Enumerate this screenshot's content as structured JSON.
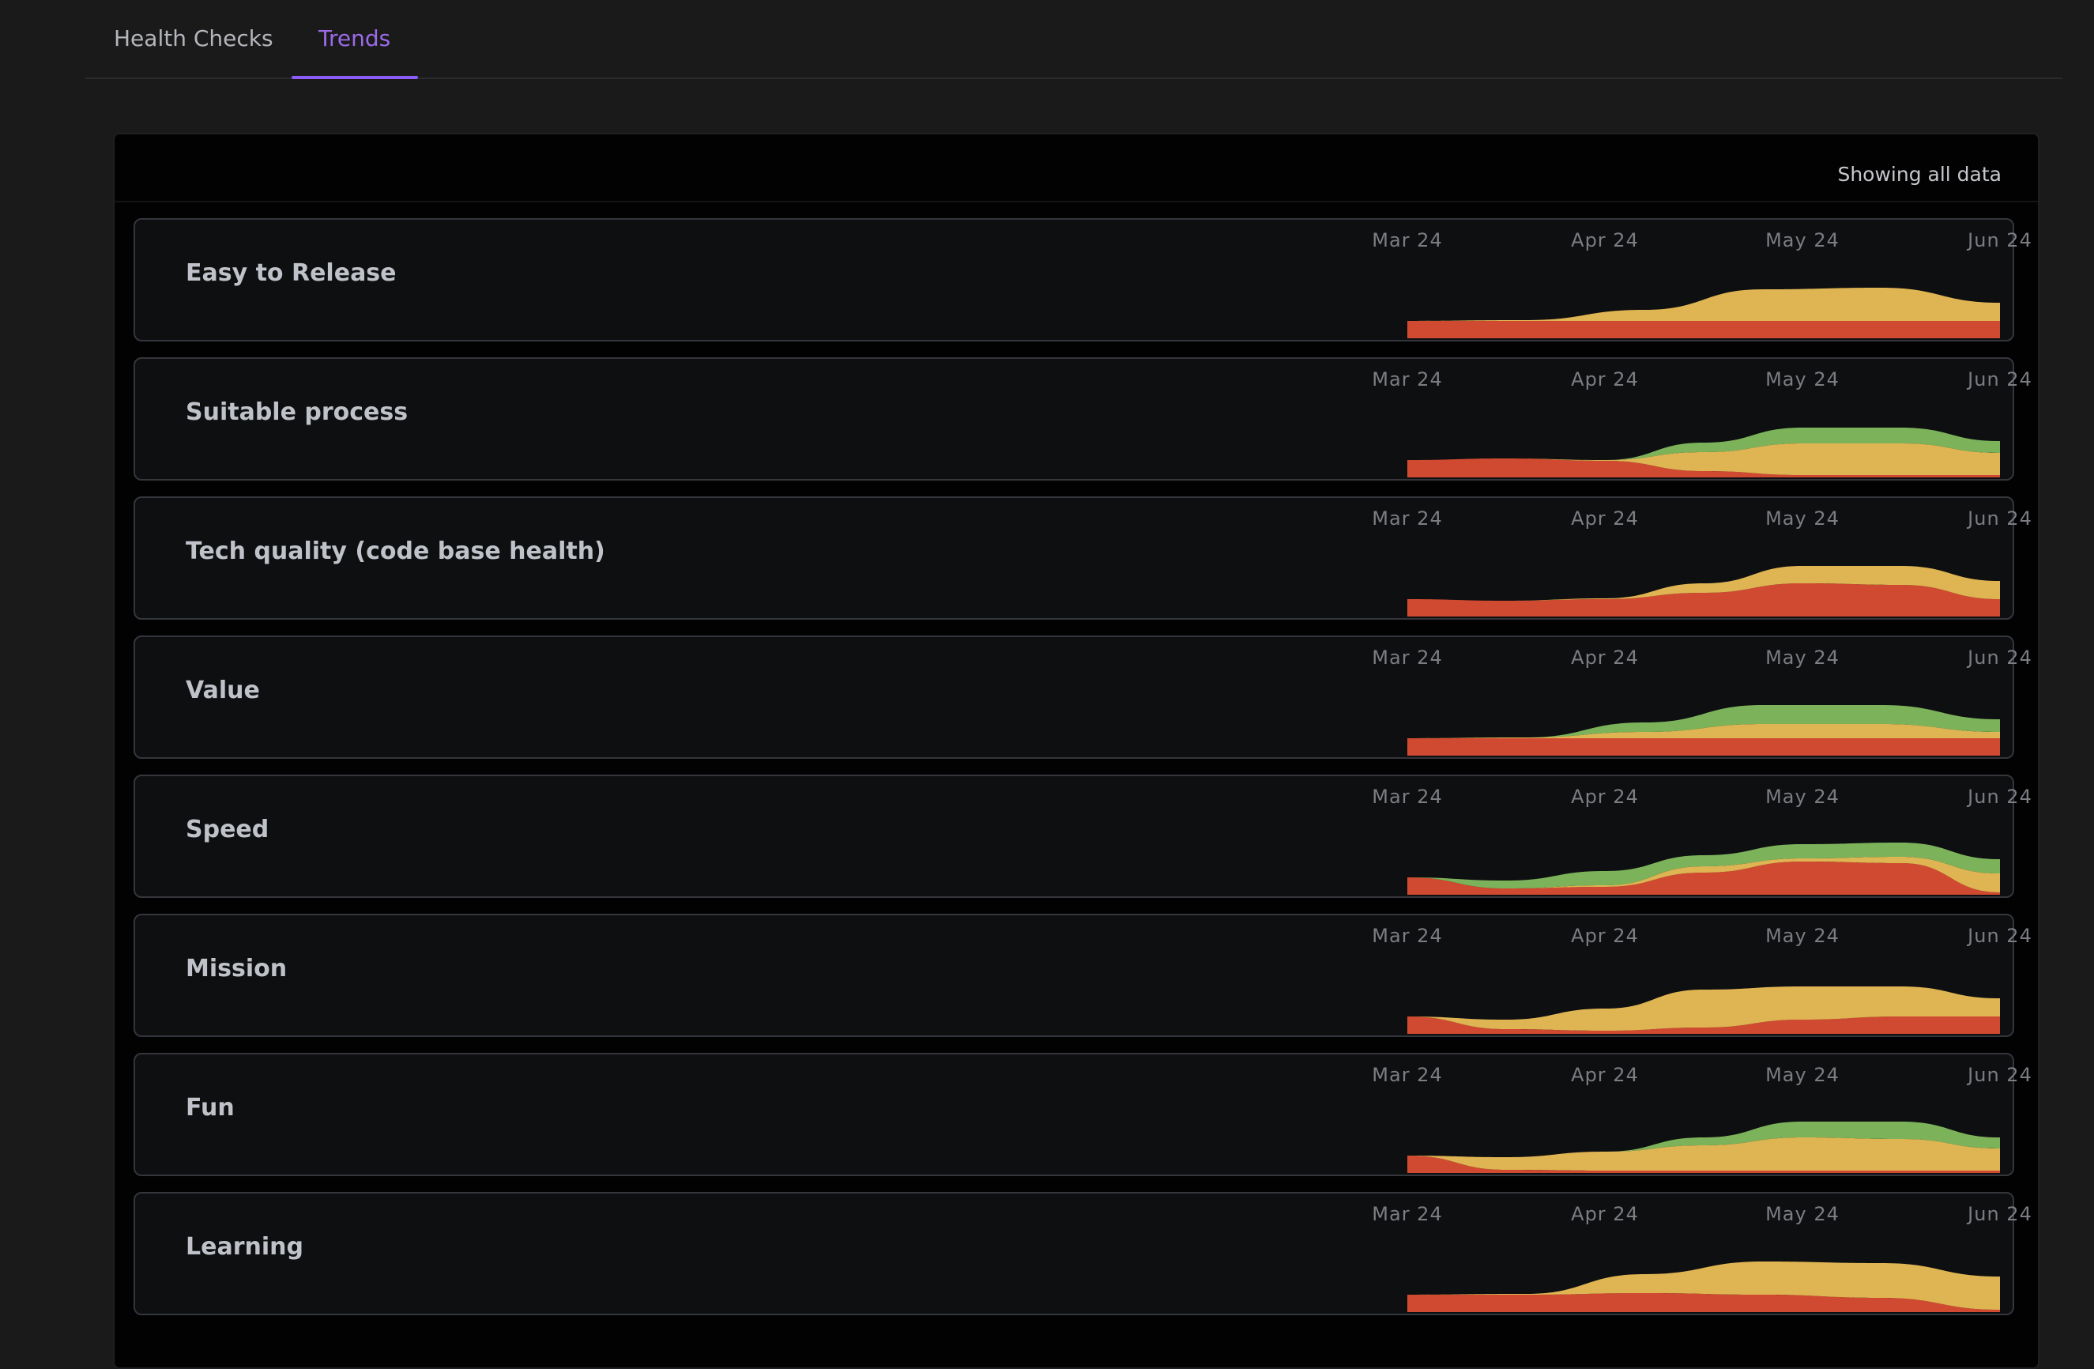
{
  "tabs": [
    {
      "label": "Health Checks",
      "active": false
    },
    {
      "label": "Trends",
      "active": true
    }
  ],
  "panel": {
    "showing_label": "Showing all data"
  },
  "colors": {
    "red": "#d04a31",
    "yellow": "#dfb452",
    "green": "#7cb35a",
    "accent": "#8b5cf6"
  },
  "months": [
    "Mar 24",
    "Apr 24",
    "May 24",
    "Jun 24"
  ],
  "trends": [
    {
      "name": "Easy to Release",
      "points": [
        {
          "date": "Mar 24",
          "red": 22,
          "yellow": 0,
          "green": 0
        },
        {
          "date": "Apr 24",
          "red": 22,
          "yellow": 1,
          "green": 0
        },
        {
          "date": "Apr 24b",
          "red": 22,
          "yellow": 14,
          "green": 0
        },
        {
          "date": "May 24",
          "red": 22,
          "yellow": 40,
          "green": 0
        },
        {
          "date": "May 24b",
          "red": 22,
          "yellow": 42,
          "green": 0
        },
        {
          "date": "Jun 24",
          "red": 22,
          "yellow": 23,
          "green": 0
        }
      ]
    },
    {
      "name": "Suitable process",
      "points": [
        {
          "date": "Mar 24",
          "red": 22,
          "yellow": 0,
          "green": 0
        },
        {
          "date": "Mar 24b",
          "red": 24,
          "yellow": 0,
          "green": 0
        },
        {
          "date": "Apr 24",
          "red": 21,
          "yellow": 1,
          "green": 0
        },
        {
          "date": "Apr 24b",
          "red": 8,
          "yellow": 24,
          "green": 12
        },
        {
          "date": "May 24",
          "red": 3,
          "yellow": 40,
          "green": 20
        },
        {
          "date": "May 24b",
          "red": 3,
          "yellow": 40,
          "green": 20
        },
        {
          "date": "Jun 24",
          "red": 3,
          "yellow": 28,
          "green": 15
        }
      ]
    },
    {
      "name": "Tech quality (code base health)",
      "points": [
        {
          "date": "Mar 24",
          "red": 22,
          "yellow": 0,
          "green": 0
        },
        {
          "date": "Mar 24b",
          "red": 20,
          "yellow": 0,
          "green": 0
        },
        {
          "date": "Apr 24",
          "red": 22,
          "yellow": 1,
          "green": 0
        },
        {
          "date": "Apr 24b",
          "red": 30,
          "yellow": 12,
          "green": 0
        },
        {
          "date": "May 24",
          "red": 42,
          "yellow": 22,
          "green": 0
        },
        {
          "date": "May 24b",
          "red": 40,
          "yellow": 24,
          "green": 0
        },
        {
          "date": "Jun 24",
          "red": 22,
          "yellow": 23,
          "green": 0
        }
      ]
    },
    {
      "name": "Value",
      "points": [
        {
          "date": "Mar 24",
          "red": 22,
          "yellow": 0,
          "green": 0
        },
        {
          "date": "Apr 24",
          "red": 22,
          "yellow": 1,
          "green": 0
        },
        {
          "date": "Apr 24b",
          "red": 22,
          "yellow": 8,
          "green": 12
        },
        {
          "date": "May 24",
          "red": 22,
          "yellow": 18,
          "green": 24
        },
        {
          "date": "May 24b",
          "red": 22,
          "yellow": 18,
          "green": 24
        },
        {
          "date": "Jun 24",
          "red": 22,
          "yellow": 8,
          "green": 16
        }
      ]
    },
    {
      "name": "Speed",
      "points": [
        {
          "date": "Mar 24",
          "red": 22,
          "yellow": 0,
          "green": 0
        },
        {
          "date": "Mar 24b",
          "red": 8,
          "yellow": 0,
          "green": 10
        },
        {
          "date": "Apr 24",
          "red": 10,
          "yellow": 2,
          "green": 18
        },
        {
          "date": "Apr 24b",
          "red": 28,
          "yellow": 8,
          "green": 14
        },
        {
          "date": "May 24",
          "red": 42,
          "yellow": 4,
          "green": 18
        },
        {
          "date": "May 24b",
          "red": 40,
          "yellow": 8,
          "green": 18
        },
        {
          "date": "Jun 24",
          "red": 3,
          "yellow": 24,
          "green": 18
        }
      ]
    },
    {
      "name": "Mission",
      "points": [
        {
          "date": "Mar 24",
          "red": 22,
          "yellow": 0,
          "green": 0
        },
        {
          "date": "Mar 24b",
          "red": 6,
          "yellow": 12,
          "green": 0
        },
        {
          "date": "Apr 24",
          "red": 4,
          "yellow": 28,
          "green": 0
        },
        {
          "date": "Apr 24b",
          "red": 8,
          "yellow": 48,
          "green": 0
        },
        {
          "date": "May 24",
          "red": 18,
          "yellow": 42,
          "green": 0
        },
        {
          "date": "May 24b",
          "red": 22,
          "yellow": 38,
          "green": 0
        },
        {
          "date": "Jun 24",
          "red": 22,
          "yellow": 23,
          "green": 0
        }
      ]
    },
    {
      "name": "Fun",
      "points": [
        {
          "date": "Mar 24",
          "red": 22,
          "yellow": 0,
          "green": 0
        },
        {
          "date": "Mar 24b",
          "red": 4,
          "yellow": 16,
          "green": 0
        },
        {
          "date": "Apr 24",
          "red": 3,
          "yellow": 24,
          "green": 0
        },
        {
          "date": "Apr 24b",
          "red": 3,
          "yellow": 32,
          "green": 10
        },
        {
          "date": "May 24",
          "red": 3,
          "yellow": 42,
          "green": 20
        },
        {
          "date": "May 24b",
          "red": 3,
          "yellow": 40,
          "green": 22
        },
        {
          "date": "Jun 24",
          "red": 3,
          "yellow": 28,
          "green": 14
        }
      ]
    },
    {
      "name": "Learning",
      "points": [
        {
          "date": "Mar 24",
          "red": 22,
          "yellow": 0,
          "green": 0
        },
        {
          "date": "Apr 24",
          "red": 22,
          "yellow": 1,
          "green": 0
        },
        {
          "date": "Apr 24b",
          "red": 24,
          "yellow": 24,
          "green": 0
        },
        {
          "date": "May 24",
          "red": 22,
          "yellow": 42,
          "green": 0
        },
        {
          "date": "May 24b",
          "red": 18,
          "yellow": 44,
          "green": 0
        },
        {
          "date": "Jun 24",
          "red": 3,
          "yellow": 42,
          "green": 0
        }
      ]
    }
  ]
}
